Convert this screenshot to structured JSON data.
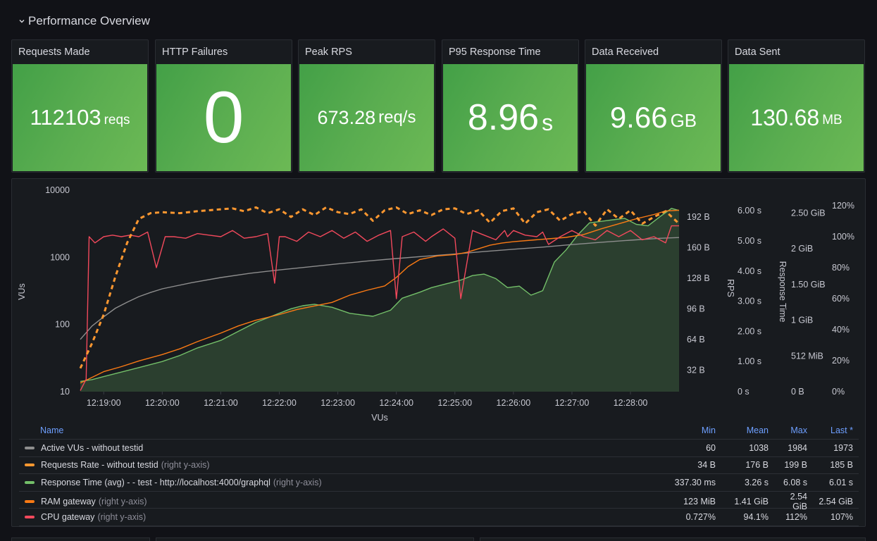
{
  "row": {
    "title": "Performance Overview",
    "collapse_icon": "chevron-down-icon"
  },
  "stats": [
    {
      "title": "Requests Made",
      "value": "112103",
      "unit": "reqs",
      "color": "#56a64b"
    },
    {
      "title": "HTTP Failures",
      "value": "0",
      "unit": "",
      "color": "#56a64b"
    },
    {
      "title": "Peak RPS",
      "value": "673.28",
      "unit": "req/s",
      "color": "#56a64b"
    },
    {
      "title": "P95 Response Time",
      "value": "8.96",
      "unit": "s",
      "color": "#56a64b"
    },
    {
      "title": "Data Received",
      "value": "9.66",
      "unit": "GB",
      "color": "#56a64b"
    },
    {
      "title": "Data Sent",
      "value": "130.68",
      "unit": "MB",
      "color": "#56a64b"
    }
  ],
  "chart_data": {
    "type": "line",
    "title": "",
    "xlabel": "VUs",
    "x_ticks": [
      "12:19:00",
      "12:20:00",
      "12:21:00",
      "12:22:00",
      "12:23:00",
      "12:24:00",
      "12:25:00",
      "12:26:00",
      "12:27:00",
      "12:28:00"
    ],
    "x_range_minutes": [
      -0.4,
      9.83
    ],
    "grid": false,
    "legend_placement": "bottom",
    "axes": {
      "left": {
        "label": "VUs",
        "scale": "log",
        "ticks": [
          "10",
          "100",
          "1000",
          "10000"
        ],
        "range": [
          10,
          10000
        ]
      },
      "rps": {
        "label": "RPS",
        "ticks": [
          "32 B",
          "64 B",
          "96 B",
          "128 B",
          "160 B",
          "192 B"
        ],
        "range": [
          0,
          208
        ]
      },
      "response_time": {
        "label": "Response Time",
        "ticks": [
          "0 s",
          "1.00 s",
          "2.00 s",
          "3.00 s",
          "4.00 s",
          "5.00 s",
          "6.00 s"
        ],
        "range": [
          0,
          6.5
        ]
      },
      "ram": {
        "label": "",
        "ticks": [
          "0 B",
          "512 MiB",
          "1 GiB",
          "1.50 GiB",
          "2 GiB",
          "2.50 GiB"
        ],
        "range": [
          0,
          2.6
        ]
      },
      "cpu": {
        "label": "",
        "ticks": [
          "0%",
          "20%",
          "40%",
          "60%",
          "80%",
          "100%",
          "120%"
        ],
        "range": [
          0,
          120
        ]
      }
    },
    "series": [
      {
        "name": "Active VUs - without testid",
        "axis": "left",
        "color": "#8e8e8e",
        "style": "line",
        "x": [
          -0.4,
          -0.2,
          0,
          0.2,
          0.4,
          0.6,
          0.8,
          1,
          1.5,
          2,
          2.5,
          3,
          3.5,
          4,
          4.5,
          5,
          5.5,
          6,
          6.5,
          7,
          7.5,
          8,
          8.5,
          9,
          9.5,
          9.83
        ],
        "values": [
          60,
          95,
          130,
          175,
          215,
          260,
          300,
          340,
          420,
          500,
          580,
          650,
          720,
          800,
          880,
          960,
          1040,
          1120,
          1220,
          1320,
          1420,
          1550,
          1680,
          1800,
          1920,
          1973
        ]
      },
      {
        "name": "Requests Rate - without testid",
        "axis": "rps",
        "color": "#ff9830",
        "style": "dashed",
        "x": [
          -0.4,
          -0.2,
          0,
          0.2,
          0.4,
          0.6,
          0.8,
          1,
          1.3,
          1.6,
          2,
          2.2,
          2.4,
          2.6,
          2.8,
          3,
          3.2,
          3.4,
          3.6,
          3.8,
          4,
          4.2,
          4.4,
          4.6,
          4.8,
          5,
          5.2,
          5.4,
          5.6,
          5.8,
          6,
          6.2,
          6.4,
          6.6,
          6.8,
          7,
          7.2,
          7.4,
          7.6,
          7.8,
          8,
          8.2,
          8.4,
          8.6,
          8.8,
          9,
          9.2,
          9.4,
          9.6,
          9.83
        ],
        "values": [
          34,
          60,
          90,
          130,
          165,
          190,
          196,
          197,
          196,
          198,
          200,
          201,
          198,
          202,
          196,
          200,
          192,
          200,
          194,
          202,
          197,
          195,
          200,
          188,
          199,
          202,
          195,
          199,
          194,
          200,
          201,
          195,
          199,
          186,
          198,
          201,
          185,
          197,
          200,
          188,
          195,
          198,
          183,
          200,
          190,
          199,
          185,
          192,
          198,
          185
        ]
      },
      {
        "name": "Response Time (avg) - - test - http://localhost:4000/graphql",
        "axis": "response_time",
        "color": "#73bf69",
        "style": "area",
        "x": [
          -0.4,
          -0.2,
          0,
          0.3,
          0.6,
          1,
          1.3,
          1.6,
          2,
          2.3,
          2.6,
          3,
          3.2,
          3.4,
          3.6,
          3.9,
          4.2,
          4.4,
          4.6,
          4.9,
          5.1,
          5.4,
          5.6,
          5.9,
          6.1,
          6.3,
          6.5,
          6.7,
          6.9,
          7.1,
          7.3,
          7.5,
          7.7,
          7.9,
          8.1,
          8.3,
          8.5,
          8.7,
          8.9,
          9.1,
          9.3,
          9.5,
          9.7,
          9.83
        ],
        "values": [
          0.34,
          0.4,
          0.5,
          0.65,
          0.8,
          1.0,
          1.2,
          1.45,
          1.7,
          2.0,
          2.3,
          2.6,
          2.75,
          2.85,
          2.9,
          2.8,
          2.6,
          2.55,
          2.5,
          2.7,
          3.1,
          3.3,
          3.45,
          3.6,
          3.7,
          3.85,
          3.9,
          3.75,
          3.45,
          3.5,
          3.2,
          3.35,
          4.3,
          4.7,
          5.2,
          5.6,
          5.65,
          5.7,
          5.75,
          5.55,
          5.5,
          5.8,
          6.08,
          6.01
        ]
      },
      {
        "name": "RAM gateway",
        "axis": "ram",
        "color": "#fa7a14",
        "style": "line",
        "x": [
          -0.4,
          -0.2,
          0,
          0.3,
          0.6,
          1,
          1.3,
          1.6,
          2,
          2.3,
          2.6,
          3,
          3.3,
          3.6,
          3.9,
          4.2,
          4.5,
          4.8,
          5,
          5.2,
          5.4,
          5.7,
          6,
          6.2,
          6.4,
          6.6,
          6.8,
          7,
          7.3,
          7.6,
          7.9,
          8.2,
          8.5,
          8.8,
          9.1,
          9.4,
          9.6,
          9.83
        ],
        "values": [
          0.12,
          0.2,
          0.28,
          0.35,
          0.43,
          0.52,
          0.6,
          0.7,
          0.82,
          0.92,
          1.0,
          1.08,
          1.15,
          1.2,
          1.25,
          1.35,
          1.42,
          1.48,
          1.6,
          1.75,
          1.85,
          1.9,
          1.92,
          1.95,
          2.0,
          2.05,
          2.08,
          2.1,
          2.12,
          2.14,
          2.16,
          2.2,
          2.28,
          2.35,
          2.42,
          2.48,
          2.53,
          2.54
        ]
      },
      {
        "name": "CPU gateway",
        "axis": "cpu",
        "color": "#f2495c",
        "style": "line",
        "x": [
          -0.4,
          -0.3,
          -0.25,
          -0.15,
          0,
          0.15,
          0.3,
          0.45,
          0.6,
          0.75,
          0.9,
          1.05,
          1.2,
          1.4,
          1.6,
          1.8,
          2,
          2.2,
          2.4,
          2.6,
          2.8,
          2.92,
          3,
          3.1,
          3.3,
          3.5,
          3.7,
          3.9,
          4.1,
          4.3,
          4.5,
          4.7,
          4.9,
          5,
          5.1,
          5.3,
          5.5,
          5.6,
          5.8,
          6,
          6.1,
          6.3,
          6.5,
          6.7,
          6.85,
          6.9,
          7.0,
          7.2,
          7.4,
          7.5,
          7.6,
          7.8,
          8.0,
          8.2,
          8.4,
          8.6,
          8.8,
          9,
          9.2,
          9.4,
          9.6,
          9.7,
          9.83
        ],
        "values": [
          0.7,
          8,
          100,
          96,
          100,
          101,
          100,
          101,
          100,
          103,
          80,
          100,
          100,
          99,
          102,
          101,
          100,
          104,
          99,
          100,
          102,
          70,
          100,
          100,
          97,
          103,
          100,
          104,
          99,
          103,
          97,
          101,
          104,
          60,
          100,
          103,
          97,
          100,
          105,
          99,
          60,
          104,
          101,
          98,
          104,
          100,
          104,
          101,
          100,
          103,
          95,
          100,
          104,
          100,
          98,
          104,
          100,
          104,
          98,
          100,
          96,
          107,
          107
        ]
      }
    ]
  },
  "legend": {
    "headers": {
      "name": "Name",
      "min": "Min",
      "mean": "Mean",
      "max": "Max",
      "last": "Last *"
    },
    "axis_note": "(right y-axis)",
    "rows": [
      {
        "name": "Active VUs - without testid",
        "note": "",
        "color": "#8e8e8e",
        "min": "60",
        "mean": "1038",
        "max": "1984",
        "last": "1973"
      },
      {
        "name": "Requests Rate - without testid",
        "note": "(right y-axis)",
        "color": "#ff9830",
        "min": "34 B",
        "mean": "176 B",
        "max": "199 B",
        "last": "185 B"
      },
      {
        "name": "Response Time (avg) - - test - http://localhost:4000/graphql",
        "note": "(right y-axis)",
        "color": "#73bf69",
        "min": "337.30 ms",
        "mean": "3.26 s",
        "max": "6.08 s",
        "last": "6.01 s"
      },
      {
        "name": "RAM gateway",
        "note": "(right y-axis)",
        "color": "#fa7a14",
        "min": "123 MiB",
        "mean": "1.41 GiB",
        "max": "2.54 GiB",
        "last": "2.54 GiB"
      },
      {
        "name": "CPU gateway",
        "note": "(right y-axis)",
        "color": "#f2495c",
        "min": "0.727%",
        "mean": "94.1%",
        "max": "112%",
        "last": "107%"
      }
    ]
  }
}
